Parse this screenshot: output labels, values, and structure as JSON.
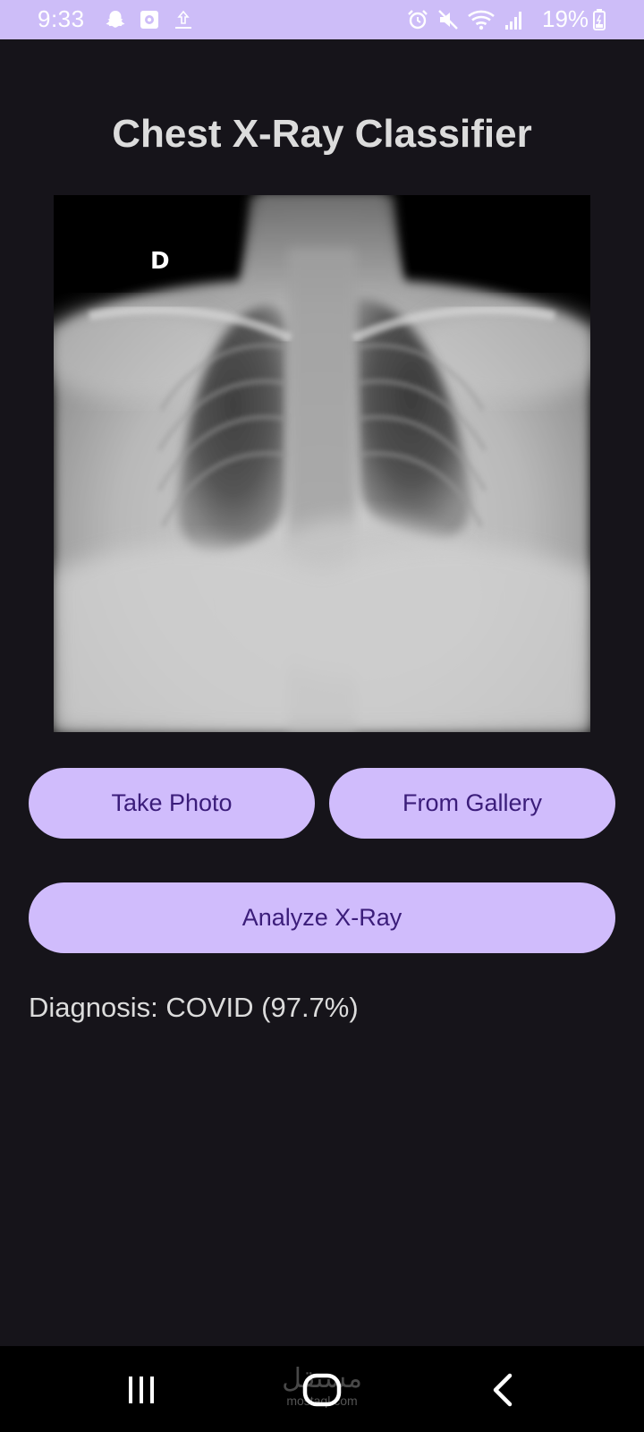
{
  "status_bar": {
    "time": "9:33",
    "battery": "19%",
    "left_icons": [
      "snapchat-icon",
      "media-icon",
      "upload-icon"
    ],
    "right_icons": [
      "alarm-icon",
      "mute-icon",
      "wifi-icon",
      "signal-icon",
      "battery-icon"
    ],
    "background": "#cdbdf8"
  },
  "app": {
    "title": "Chest X-Ray Classifier",
    "image_marker": "D",
    "buttons": {
      "take_photo": "Take Photo",
      "from_gallery": "From Gallery",
      "analyze": "Analyze X-Ray"
    },
    "diagnosis": "Diagnosis: COVID (97.7%)",
    "colors": {
      "background": "#16141a",
      "button": "#d0bcfc",
      "button_text": "#3b1d7a",
      "text": "#dcdcdc"
    }
  },
  "nav_bar": {
    "icons": [
      "recent-apps-icon",
      "home-icon",
      "back-icon"
    ],
    "watermark_main": "مستقل",
    "watermark_sub": "mostaql.com"
  }
}
